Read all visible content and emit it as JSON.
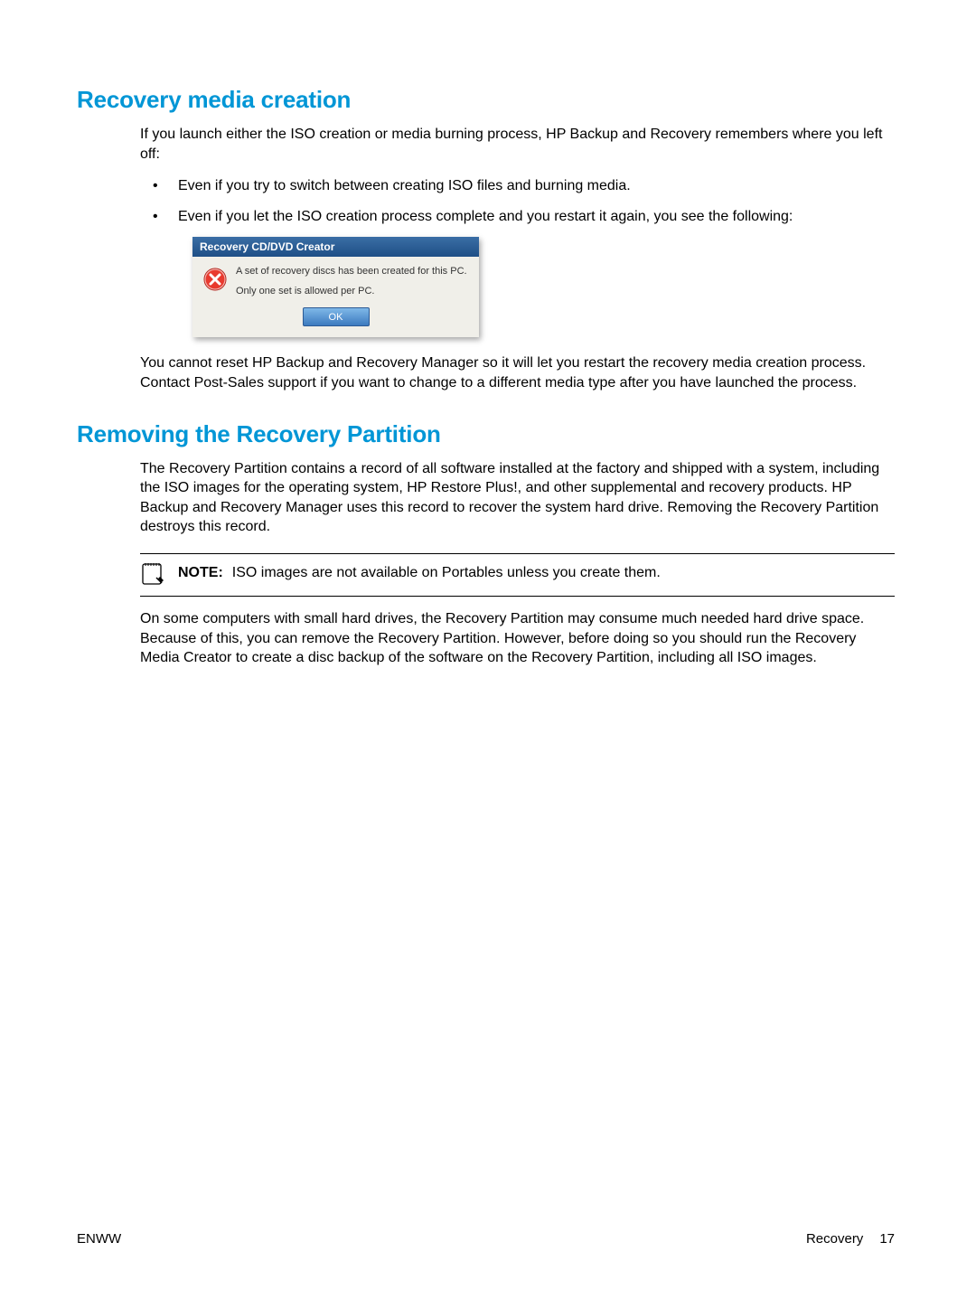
{
  "section1": {
    "heading": "Recovery media creation",
    "intro": "If you launch either the ISO creation or media burning process, HP Backup and Recovery remembers where you left off:",
    "bullets": [
      "Even if you try to switch between creating ISO files and burning media.",
      "Even if you let the ISO creation process complete and you restart it again, you see the following:"
    ],
    "after_dialog": "You cannot reset HP Backup and Recovery Manager so it will let you restart the recovery media creation process. Contact Post-Sales support if you want to change to a different media type after you have launched the process."
  },
  "dialog": {
    "title": "Recovery CD/DVD Creator",
    "message1": "A set of recovery discs has been created for this PC.",
    "message2": "Only one set is allowed per PC.",
    "ok": "OK"
  },
  "section2": {
    "heading": "Removing the Recovery Partition",
    "para1": "The Recovery Partition contains a record of all software installed at the factory and shipped with a system, including the ISO images for the operating system, HP Restore Plus!, and other supplemental and recovery products. HP Backup and Recovery Manager uses this record to recover the system hard drive. Removing the Recovery Partition destroys this record.",
    "note_label": "NOTE:",
    "note_text": "ISO images are not available on Portables unless you create them.",
    "para2": "On some computers with small hard drives, the Recovery Partition may consume much needed hard drive space. Because of this, you can remove the Recovery Partition. However, before doing so you should run the Recovery Media Creator to create a disc backup of the software on the Recovery Partition, including all ISO images."
  },
  "footer": {
    "left": "ENWW",
    "right_label": "Recovery",
    "page": "17"
  }
}
